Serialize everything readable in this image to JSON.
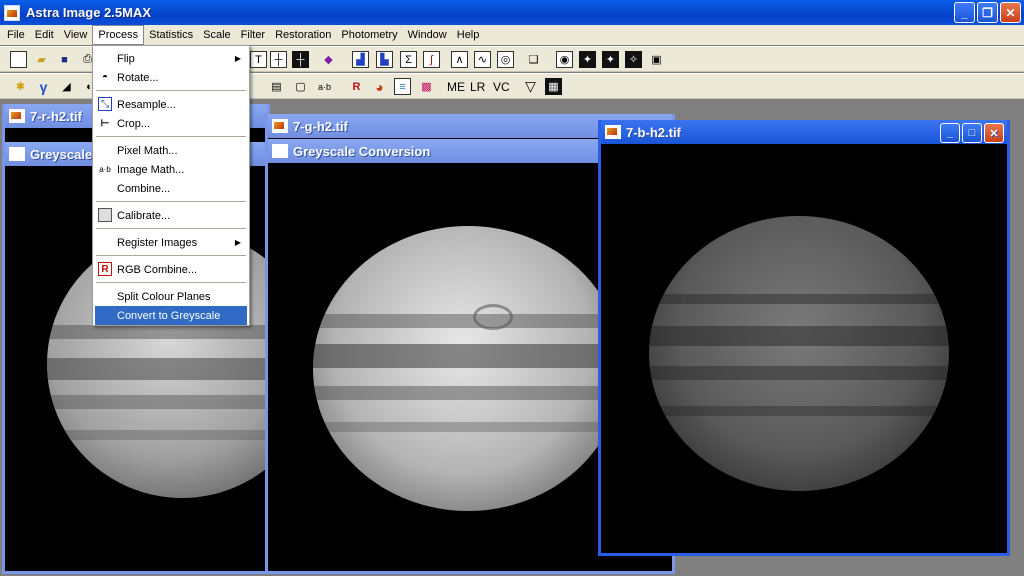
{
  "window": {
    "title": "Astra Image 2.5MAX"
  },
  "menubar": [
    "File",
    "Edit",
    "View",
    "Process",
    "Statistics",
    "Scale",
    "Filter",
    "Restoration",
    "Photometry",
    "Window",
    "Help"
  ],
  "toolbar2_text": {
    "ab": "a·b",
    "me": "ME",
    "lr": "LR",
    "vc": "VC"
  },
  "process_menu": {
    "items": [
      {
        "label": "Flip",
        "icon": "",
        "submenu": true
      },
      {
        "label": "Rotate...",
        "icon": "rotate-icon",
        "submenu": false
      },
      {
        "label": "Resample...",
        "icon": "resample-icon",
        "submenu": false
      },
      {
        "label": "Crop...",
        "icon": "crop-icon",
        "submenu": false
      },
      {
        "label": "Pixel Math...",
        "icon": "",
        "submenu": false
      },
      {
        "label": "Image Math...",
        "icon": "image-math-icon",
        "submenu": false
      },
      {
        "label": "Combine...",
        "icon": "",
        "submenu": false
      },
      {
        "label": "Calibrate...",
        "icon": "calibrate-icon",
        "submenu": false
      },
      {
        "label": "Register Images",
        "icon": "",
        "submenu": true
      },
      {
        "label": "RGB Combine...",
        "icon": "rgb-combine-icon",
        "submenu": false
      },
      {
        "label": "Split Colour Planes",
        "icon": "",
        "submenu": false
      },
      {
        "label": "Convert to Greyscale",
        "icon": "",
        "submenu": false,
        "selected": true
      }
    ]
  },
  "windows": {
    "red": {
      "title": "7-r-h2.tif",
      "child_title": "Greyscale C"
    },
    "green": {
      "title": "7-g-h2.tif",
      "child_title": "Greyscale Conversion"
    },
    "blue": {
      "title": "7-b-h2.tif"
    }
  }
}
